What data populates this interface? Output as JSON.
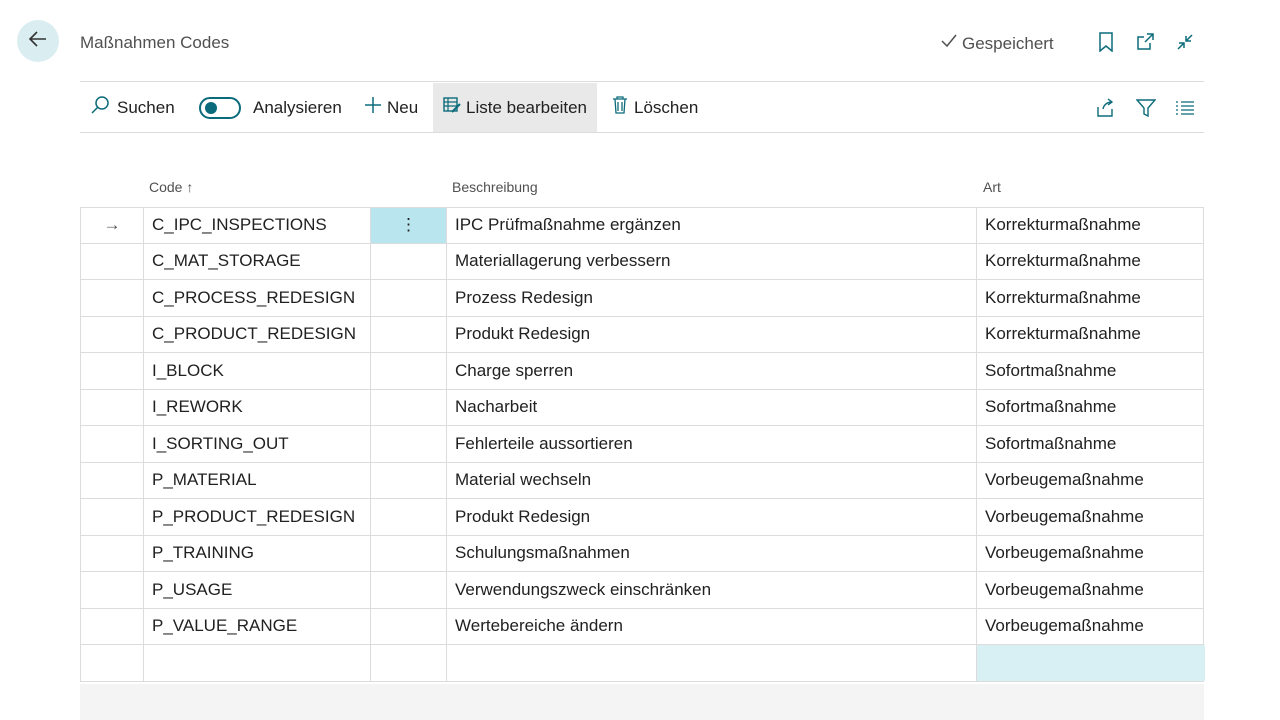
{
  "header": {
    "title": "Maßnahmen Codes",
    "saved_status": "Gespeichert",
    "icons": [
      "back-arrow-icon",
      "bookmark-icon",
      "open-new-window-icon",
      "collapse-icon"
    ]
  },
  "toolbar": {
    "search_label": "Suchen",
    "analyze_label": "Analysieren",
    "analyze_toggle_on": true,
    "new_label": "Neu",
    "edit_list_label": "Liste bearbeiten",
    "delete_label": "Löschen",
    "right_icons": [
      "share-icon",
      "filter-icon",
      "list-view-icon"
    ]
  },
  "columns": {
    "code": "Code",
    "code_sort_indicator": "↑",
    "description": "Beschreibung",
    "type": "Art"
  },
  "rows": [
    {
      "code": "C_IPC_INSPECTIONS",
      "description": "IPC Prüfmaßnahme ergänzen",
      "type": "Korrekturmaßnahme"
    },
    {
      "code": "C_MAT_STORAGE",
      "description": "Materiallagerung verbessern",
      "type": "Korrekturmaßnahme"
    },
    {
      "code": "C_PROCESS_REDESIGN",
      "description": "Prozess Redesign",
      "type": "Korrekturmaßnahme"
    },
    {
      "code": "C_PRODUCT_REDESIGN",
      "description": "Produkt Redesign",
      "type": "Korrekturmaßnahme"
    },
    {
      "code": "I_BLOCK",
      "description": "Charge sperren",
      "type": "Sofortmaßnahme"
    },
    {
      "code": "I_REWORK",
      "description": "Nacharbeit",
      "type": "Sofortmaßnahme"
    },
    {
      "code": "I_SORTING_OUT",
      "description": "Fehlerteile aussortieren",
      "type": "Sofortmaßnahme"
    },
    {
      "code": "P_MATERIAL",
      "description": "Material wechseln",
      "type": "Vorbeugemaßnahme"
    },
    {
      "code": "P_PRODUCT_REDESIGN",
      "description": "Produkt Redesign",
      "type": "Vorbeugemaßnahme"
    },
    {
      "code": "P_TRAINING",
      "description": "Schulungsmaßnahmen",
      "type": "Vorbeugemaßnahme"
    },
    {
      "code": "P_USAGE",
      "description": "Verwendungszweck einschränken",
      "type": "Vorbeugemaßnahme"
    },
    {
      "code": "P_VALUE_RANGE",
      "description": "Wertebereiche ändern",
      "type": "Vorbeugemaßnahme"
    }
  ],
  "current_row_marker": "→",
  "row_menu_glyph": "⋮",
  "accent_color": "#0b6b7a",
  "selection_color": "#b9e6ee"
}
